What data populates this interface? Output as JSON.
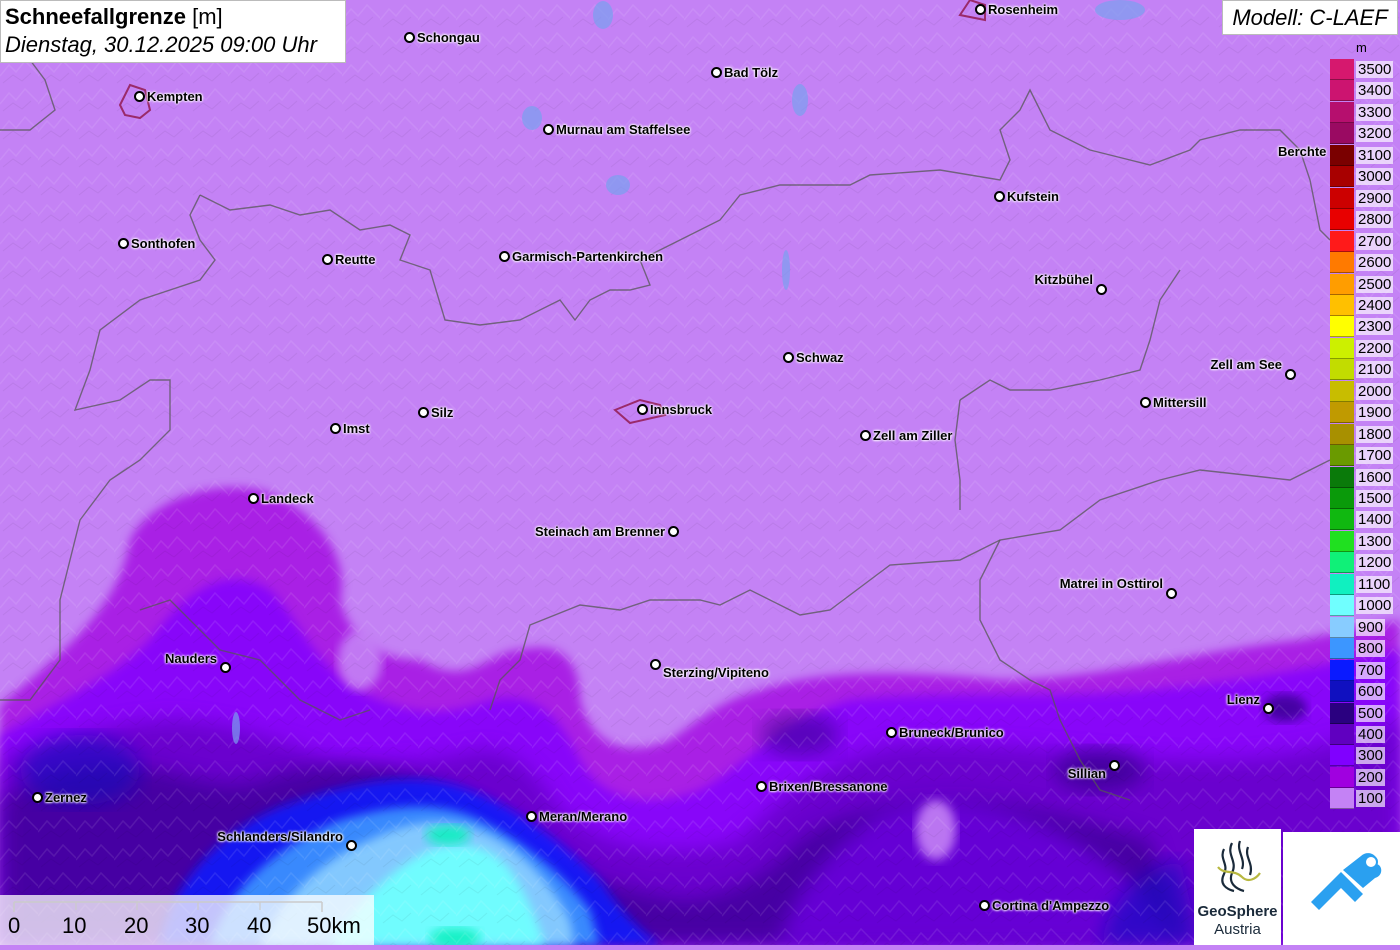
{
  "title": {
    "main": "Schneefallgrenze",
    "unit": "[m]",
    "datetime": "Dienstag, 30.12.2025 09:00 Uhr"
  },
  "model": "Modell: C-LAEF",
  "legend": {
    "unit": "m",
    "items": [
      {
        "label": "3500",
        "color": "#d6186e"
      },
      {
        "label": "3400",
        "color": "#cc1470"
      },
      {
        "label": "3300",
        "color": "#b60f6e"
      },
      {
        "label": "3200",
        "color": "#9a0a62"
      },
      {
        "label": "3100",
        "color": "#7a0000"
      },
      {
        "label": "3000",
        "color": "#a80000"
      },
      {
        "label": "2900",
        "color": "#cc0000"
      },
      {
        "label": "2800",
        "color": "#e80000"
      },
      {
        "label": "2700",
        "color": "#ff1a1a"
      },
      {
        "label": "2600",
        "color": "#ff7a00"
      },
      {
        "label": "2500",
        "color": "#ff9d00"
      },
      {
        "label": "2400",
        "color": "#ffc000"
      },
      {
        "label": "2300",
        "color": "#ffff00"
      },
      {
        "label": "2200",
        "color": "#ccf000"
      },
      {
        "label": "2100",
        "color": "#c2dc00"
      },
      {
        "label": "2000",
        "color": "#c8bd00"
      },
      {
        "label": "1900",
        "color": "#c09a00"
      },
      {
        "label": "1800",
        "color": "#a89000"
      },
      {
        "label": "1700",
        "color": "#6a9a00"
      },
      {
        "label": "1600",
        "color": "#0a7a0a"
      },
      {
        "label": "1500",
        "color": "#0a9a0a"
      },
      {
        "label": "1400",
        "color": "#10b810"
      },
      {
        "label": "1300",
        "color": "#20e020"
      },
      {
        "label": "1200",
        "color": "#10f078"
      },
      {
        "label": "1100",
        "color": "#10f0c0"
      },
      {
        "label": "1000",
        "color": "#70ffff"
      },
      {
        "label": "900",
        "color": "#88ccff"
      },
      {
        "label": "800",
        "color": "#3c96ff"
      },
      {
        "label": "700",
        "color": "#0a1aff"
      },
      {
        "label": "600",
        "color": "#1010c0"
      },
      {
        "label": "500",
        "color": "#2a0080"
      },
      {
        "label": "400",
        "color": "#6000c0"
      },
      {
        "label": "300",
        "color": "#8000ff"
      },
      {
        "label": "200",
        "color": "#a000e0"
      },
      {
        "label": "100",
        "color": "#c482f5"
      }
    ]
  },
  "cities": [
    {
      "name": "Schongau"
    },
    {
      "name": "Rosenheim"
    },
    {
      "name": "Kempten"
    },
    {
      "name": "Bad Tölz"
    },
    {
      "name": "Murnau am Staffelsee"
    },
    {
      "name": "Berchte"
    },
    {
      "name": "Kufstein"
    },
    {
      "name": "Sonthofen"
    },
    {
      "name": "Reutte"
    },
    {
      "name": "Garmisch-Partenkirchen"
    },
    {
      "name": "Kitzbühel"
    },
    {
      "name": "Schwaz"
    },
    {
      "name": "Zell am See"
    },
    {
      "name": "Mittersill"
    },
    {
      "name": "Silz"
    },
    {
      "name": "Innsbruck"
    },
    {
      "name": "Imst"
    },
    {
      "name": "Zell am Ziller"
    },
    {
      "name": "Landeck"
    },
    {
      "name": "Steinach am Brenner"
    },
    {
      "name": "Matrei in Osttirol"
    },
    {
      "name": "Nauders"
    },
    {
      "name": "Sterzing/Vipiteno"
    },
    {
      "name": "Lienz"
    },
    {
      "name": "Bruneck/Brunico"
    },
    {
      "name": "Sillian"
    },
    {
      "name": "Brixen/Bressanone"
    },
    {
      "name": "Zernez"
    },
    {
      "name": "Meran/Merano"
    },
    {
      "name": "Schlanders/Silandro"
    },
    {
      "name": "Cortina d'Ampezzo"
    }
  ],
  "scale": {
    "labels": [
      "0",
      "10",
      "20",
      "30",
      "40",
      "50km"
    ]
  },
  "logos": {
    "geosphere_line1": "GeoSphere",
    "geosphere_line2": "Austria"
  }
}
